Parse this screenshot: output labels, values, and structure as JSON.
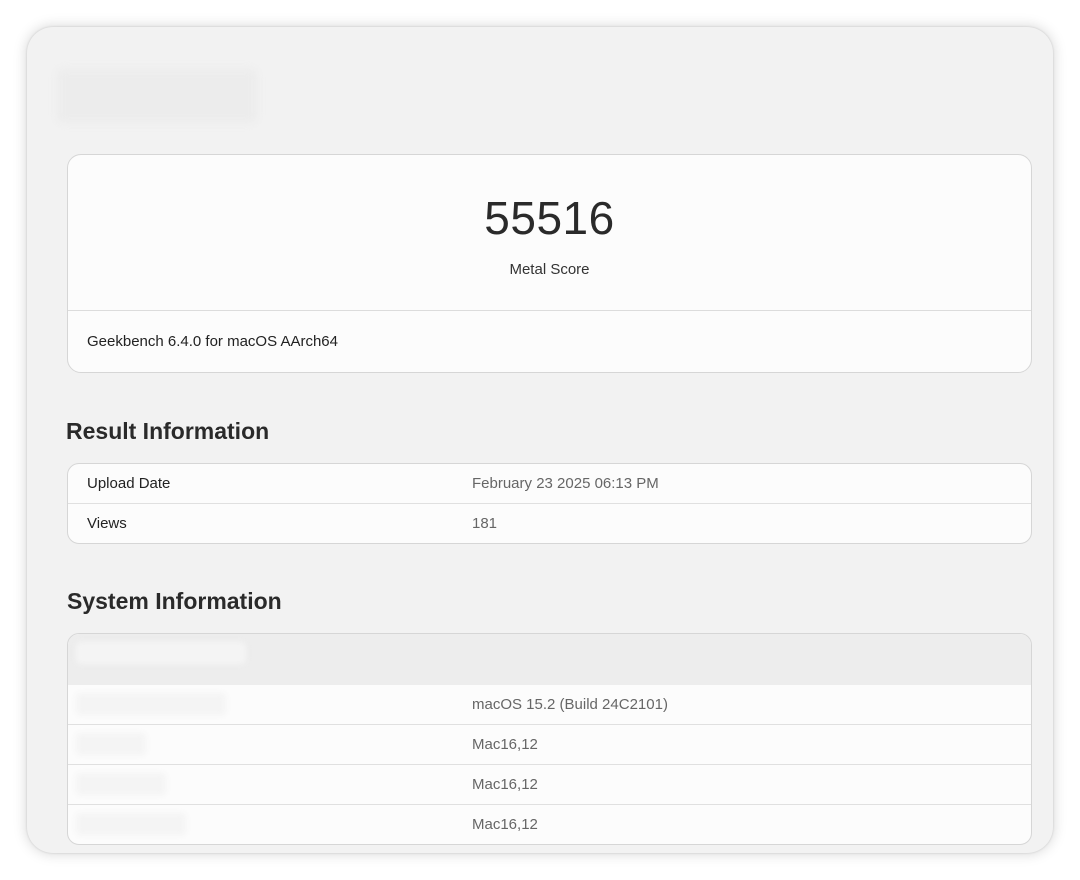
{
  "score": {
    "value": "55516",
    "label": "Metal Score",
    "version": "Geekbench 6.4.0 for macOS AArch64"
  },
  "result_information": {
    "title": "Result Information",
    "rows": [
      {
        "key": "Upload Date",
        "value": "February 23 2025 06:13 PM"
      },
      {
        "key": "Views",
        "value": "181"
      }
    ]
  },
  "system_information": {
    "title": "System Information",
    "rows": [
      {
        "value": "macOS 15.2 (Build 24C2101)"
      },
      {
        "value": "Mac16,12"
      },
      {
        "value": "Mac16,12"
      },
      {
        "value": "Mac16,12"
      }
    ]
  }
}
